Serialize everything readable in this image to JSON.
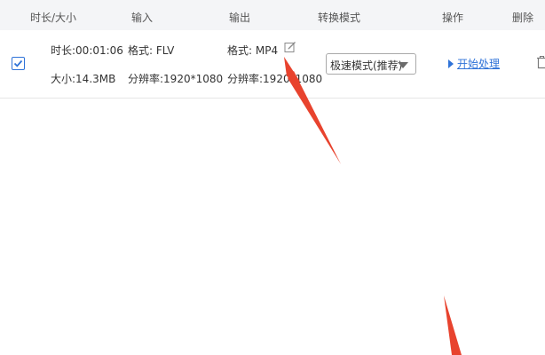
{
  "header": {
    "col_duration_size": "时长/大小",
    "col_input": "输入",
    "col_output": "输出",
    "col_mode": "转换模式",
    "col_action": "操作",
    "col_delete": "删除"
  },
  "file_row": {
    "checked": true,
    "duration": "时长:00:01:06",
    "size": "大小:14.3MB",
    "input_format": "格式: FLV",
    "input_resolution": "分辨率:1920*1080",
    "output_format": "格式: MP4",
    "output_resolution": "分辨率:1920*1080",
    "mode_selected": "极速模式(推荐)",
    "start_label": "开始处理"
  },
  "icons": {
    "checkbox": "check-icon",
    "edit": "edit-icon",
    "mode_caret": "chevron-down-icon",
    "start": "play-triangle-icon",
    "delete": "trash-icon",
    "annotation": "red-arrow"
  },
  "colors": {
    "header_bg": "#f4f5f7",
    "accent_blue": "#2f73d8",
    "annotation_red": "#e8432e"
  }
}
